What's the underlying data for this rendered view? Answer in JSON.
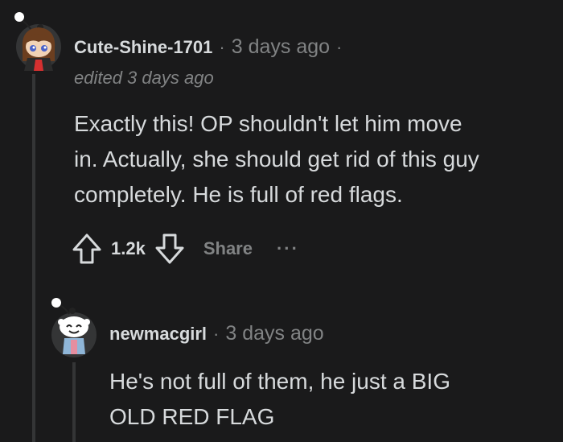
{
  "comments": [
    {
      "author": "Cute-Shine-1701",
      "separator": "·",
      "time": "3 days ago",
      "trailing_separator": "·",
      "edited": "edited 3 days ago",
      "body_lines": [
        "Exactly this! OP shouldn't let him move",
        "in. Actually, she should get rid of this guy",
        "completely. He is full of red flags."
      ],
      "votes": "1.2k",
      "share_label": "Share",
      "more_label": "···",
      "avatar_icon": "user-avatar-girl-icon"
    },
    {
      "author": "newmacgirl",
      "separator": "·",
      "time": "3 days ago",
      "body_lines": [
        "He's not full of them, he just a BIG",
        "OLD RED FLAG"
      ],
      "avatar_icon": "user-avatar-snoo-icon"
    }
  ],
  "colors": {
    "background": "#1a1a1b",
    "text": "#d7dadc",
    "muted": "#818384",
    "thread_line": "#343536"
  }
}
